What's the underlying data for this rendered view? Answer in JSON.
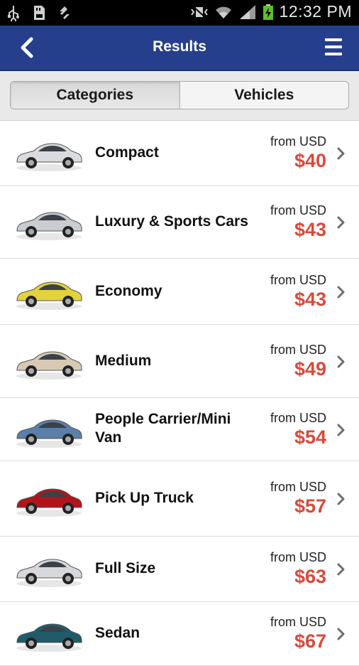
{
  "status_bar": {
    "time": "12:32 PM"
  },
  "header": {
    "title": "Results",
    "back_icon": "chevron-left-icon",
    "menu_icon": "hamburger-menu-icon"
  },
  "tabs": [
    {
      "label": "Categories",
      "active": true
    },
    {
      "label": "Vehicles",
      "active": false
    }
  ],
  "colors": {
    "app_bar": "#263f8c",
    "price": "#d84a3a"
  },
  "results": [
    {
      "name": "Compact",
      "from_label": "from USD",
      "price": "$40",
      "car_color": "#d9dbde"
    },
    {
      "name": "Luxury & Sports Cars",
      "from_label": "from USD",
      "price": "$43",
      "car_color": "#c9ccd0"
    },
    {
      "name": "Economy",
      "from_label": "from USD",
      "price": "$43",
      "car_color": "#e3d23a"
    },
    {
      "name": "Medium",
      "from_label": "from USD",
      "price": "$49",
      "car_color": "#d8c9b4"
    },
    {
      "name": "People Carrier/Mini Van",
      "from_label": "from USD",
      "price": "$54",
      "car_color": "#5a7fa8"
    },
    {
      "name": "Pick Up Truck",
      "from_label": "from USD",
      "price": "$57",
      "car_color": "#b3141c"
    },
    {
      "name": "Full Size",
      "from_label": "from USD",
      "price": "$63",
      "car_color": "#d6d8db"
    },
    {
      "name": "Sedan",
      "from_label": "from USD",
      "price": "$67",
      "car_color": "#1f5c6a"
    }
  ]
}
